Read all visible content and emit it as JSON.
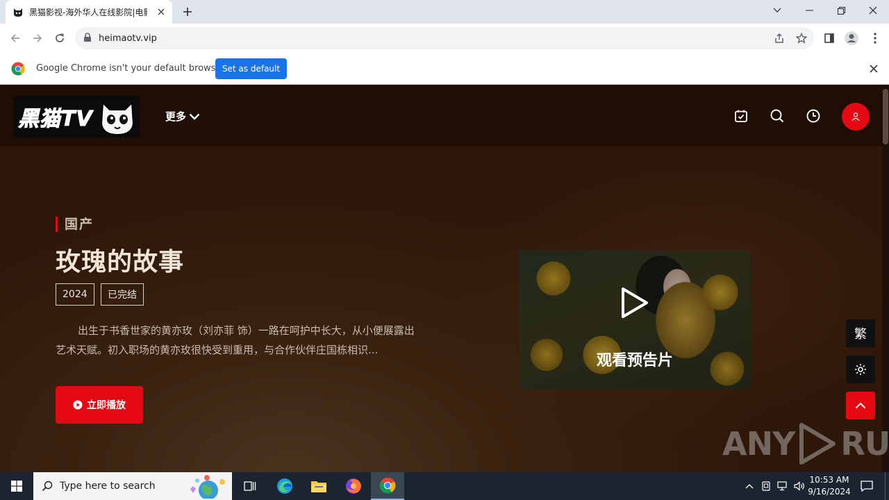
{
  "browser": {
    "tab_title": "黑猫影视-海外华人在线影院|电影",
    "url": "heimaotv.vip"
  },
  "infobar": {
    "message": "Google Chrome isn't your default browser",
    "button_label": "Set as default"
  },
  "site": {
    "logo_text": "黑猫TV",
    "nav_more": "更多",
    "accent_color": "#e50914"
  },
  "hero": {
    "genre": "国产",
    "title": "玫瑰的故事",
    "tags": [
      "2024",
      "已完结"
    ],
    "description": "出生于书香世家的黄亦玫（刘亦菲 饰）一路在呵护中长大，从小便展露出艺术天赋。初入职场的黄亦玫很快受到重用，与合作伙伴庄国栋相识...",
    "play_label": "立即播放",
    "trailer_label": "观看预告片"
  },
  "side_tools": {
    "traditional_label": "繁"
  },
  "watermark": {
    "left": "ANY",
    "right": "RUN"
  },
  "taskbar": {
    "search_placeholder": "Type here to search",
    "time": "10:53 AM",
    "date": "9/16/2024"
  }
}
